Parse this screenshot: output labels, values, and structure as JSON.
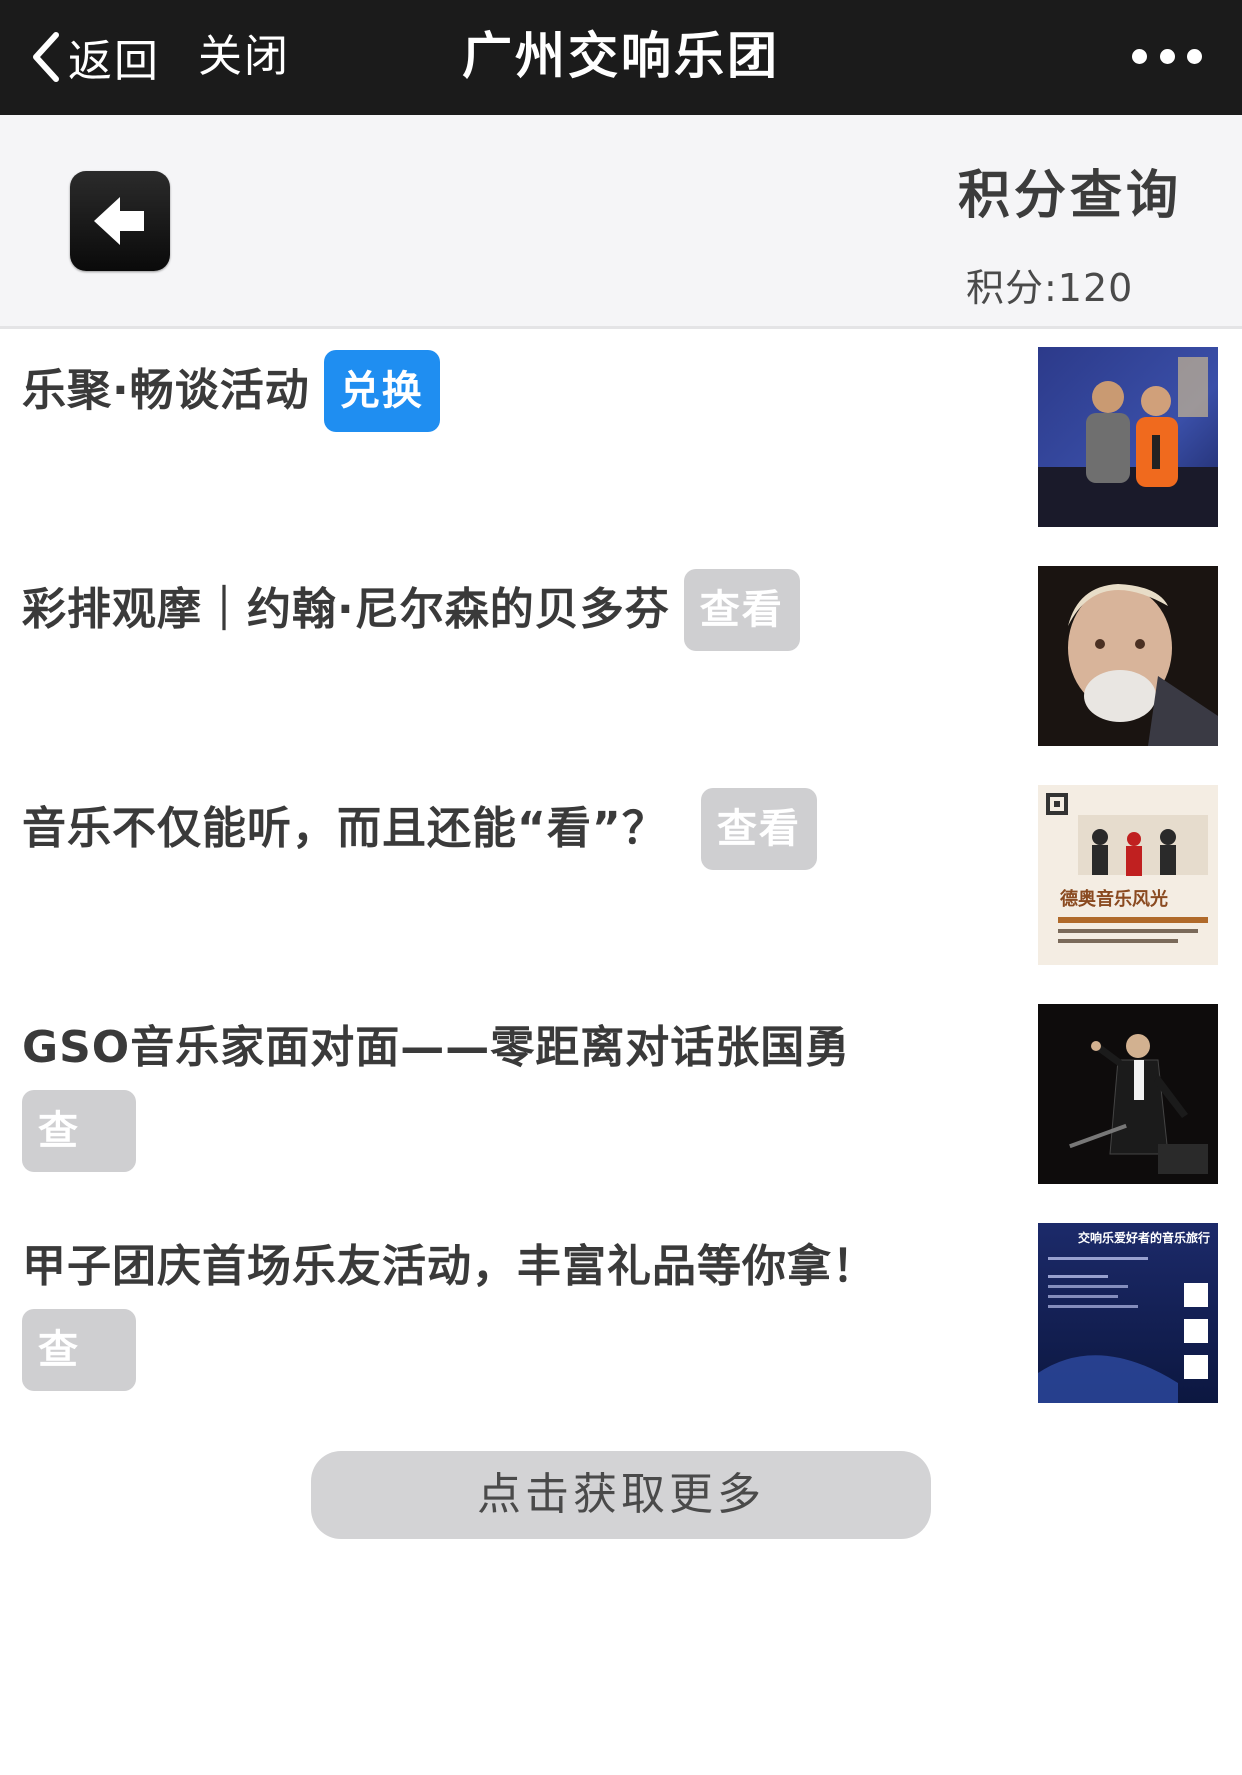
{
  "navbar": {
    "back_label": "返回",
    "close_label": "关闭",
    "title": "广州交响乐团"
  },
  "header": {
    "title": "积分查询",
    "points_text": "积分:120"
  },
  "items": [
    {
      "title": "乐聚·畅谈活动",
      "action": "兑换",
      "action_style": "primary",
      "thumb_icon": "photo-two-musicians-singing"
    },
    {
      "title": "彩排观摩｜约翰·尼尔森的贝多芬",
      "action": "查看",
      "action_style": "secondary",
      "thumb_icon": "photo-conductor-portrait"
    },
    {
      "title": "音乐不仅能听，而且还能“看”？",
      "action": "查看",
      "action_style": "secondary",
      "thumb_icon": "poster-german-austrian-music",
      "thumb_text": "德奥音乐风光"
    },
    {
      "title": "GSO音乐家面对面——零距离对话张国勇",
      "action": "查看",
      "action_style": "secondary",
      "thumb_icon": "photo-conductor-on-stage"
    },
    {
      "title": "甲子团庆首场乐友活动，丰富礼品等你拿！",
      "action": "查看",
      "action_style": "secondary",
      "thumb_icon": "poster-orchestra-event",
      "thumb_text": "交响乐爱好者的音乐旅行"
    }
  ],
  "load_more": "点击获取更多",
  "colors": {
    "navbar_bg": "#1b1b1b",
    "primary_button": "#1f8ef1",
    "secondary_button": "#cfcfd1"
  }
}
